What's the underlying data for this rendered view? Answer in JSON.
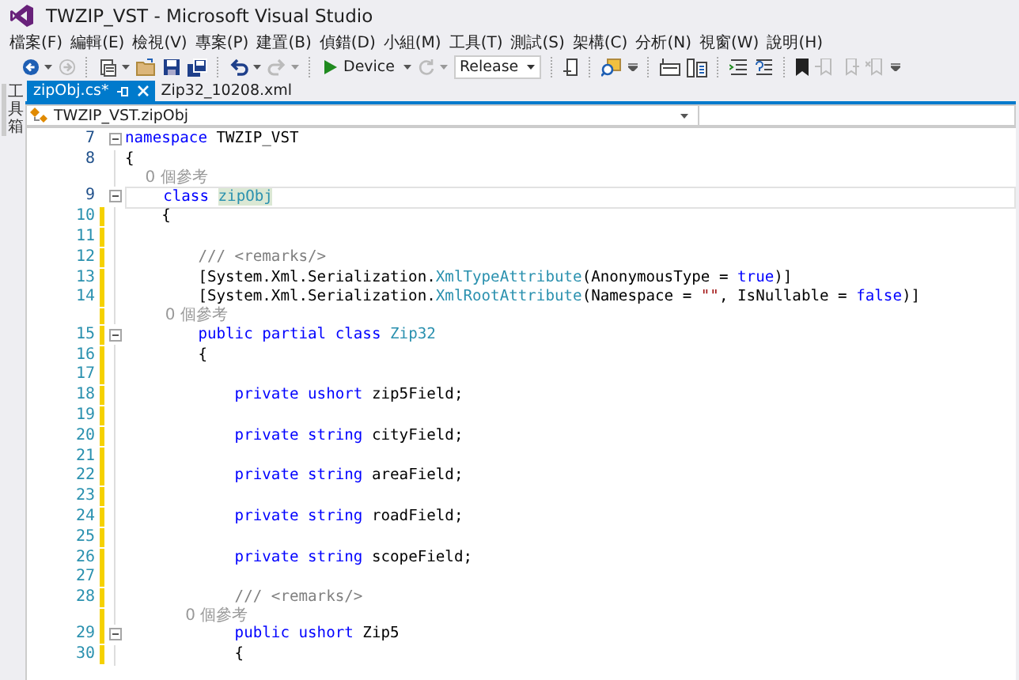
{
  "window": {
    "title": "TWZIP_VST - Microsoft Visual Studio"
  },
  "menu": [
    "檔案(F)",
    "編輯(E)",
    "檢視(V)",
    "專案(P)",
    "建置(B)",
    "偵錯(D)",
    "小組(M)",
    "工具(T)",
    "測試(S)",
    "架構(C)",
    "分析(N)",
    "視窗(W)",
    "說明(H)"
  ],
  "toolbar": {
    "forward": {
      "disabled": true
    },
    "redo": {
      "disabled": true
    },
    "run": {
      "label": "Device"
    },
    "refresh": {
      "disabled": true
    },
    "configuration": {
      "value": "Release"
    }
  },
  "side_panel": {
    "label": "工具箱"
  },
  "tabs": [
    {
      "label": "zipObj.cs*",
      "selected": true
    },
    {
      "label": "Zip32_10208.xml",
      "selected": false
    }
  ],
  "navigation_bar": {
    "value": "TWZIP_VST.zipObj"
  },
  "lines": [
    {
      "kind": "code",
      "number": "7",
      "fold": true,
      "changed": false,
      "tokens": [
        {
          "t": "namespace",
          "kind": "kw"
        },
        {
          "t": " TWZIP_VST",
          "kind": "plain"
        }
      ]
    },
    {
      "kind": "code",
      "number": "8",
      "changed": false,
      "tokens": [
        {
          "t": "{",
          "kind": "plain"
        }
      ]
    },
    {
      "kind": "codelens",
      "text": "    0 個參考"
    },
    {
      "kind": "code",
      "number": "9",
      "fold": true,
      "changed": false,
      "current": true,
      "tokens": [
        {
          "t": "    class ",
          "kind": "kw"
        },
        {
          "t": "zipObj",
          "kind": "highlight"
        }
      ]
    },
    {
      "kind": "code",
      "number": "10",
      "changed": true,
      "tokens": [
        {
          "t": "    {",
          "kind": "plain"
        }
      ]
    },
    {
      "kind": "code",
      "number": "11",
      "changed": true
    },
    {
      "kind": "code",
      "number": "12",
      "changed": true,
      "tokens": [
        {
          "t": "        /// <remarks/>",
          "kind": "comment"
        }
      ]
    },
    {
      "kind": "code",
      "number": "13",
      "changed": true,
      "tokens": [
        {
          "t": "        [System.Xml.Serialization.",
          "kind": "plain"
        },
        {
          "t": "XmlTypeAttribute",
          "kind": "type"
        },
        {
          "t": "(AnonymousType = ",
          "kind": "plain"
        },
        {
          "t": "true",
          "kind": "kw"
        },
        {
          "t": ")]",
          "kind": "plain"
        }
      ]
    },
    {
      "kind": "code",
      "number": "14",
      "changed": true,
      "tokens": [
        {
          "t": "        [System.Xml.Serialization.",
          "kind": "plain"
        },
        {
          "t": "XmlRootAttribute",
          "kind": "type"
        },
        {
          "t": "(Namespace = ",
          "kind": "plain"
        },
        {
          "t": "\"\"",
          "kind": "string"
        },
        {
          "t": ", IsNullable = ",
          "kind": "plain"
        },
        {
          "t": "false",
          "kind": "kw"
        },
        {
          "t": ")]",
          "kind": "plain"
        }
      ]
    },
    {
      "kind": "codelens",
      "changed": true,
      "text": "        0 個參考"
    },
    {
      "kind": "code",
      "number": "15",
      "fold": true,
      "changed": true,
      "tokens": [
        {
          "t": "        public partial class ",
          "kind": "kw"
        },
        {
          "t": "Zip32",
          "kind": "type"
        }
      ]
    },
    {
      "kind": "code",
      "number": "16",
      "changed": true,
      "tokens": [
        {
          "t": "        {",
          "kind": "plain"
        }
      ]
    },
    {
      "kind": "code",
      "number": "17",
      "changed": true
    },
    {
      "kind": "code",
      "number": "18",
      "changed": true,
      "tokens": [
        {
          "t": "            private ushort",
          "kind": "kw"
        },
        {
          "t": " zip5Field;",
          "kind": "plain"
        }
      ]
    },
    {
      "kind": "code",
      "number": "19",
      "changed": true
    },
    {
      "kind": "code",
      "number": "20",
      "changed": true,
      "tokens": [
        {
          "t": "            private string",
          "kind": "kw"
        },
        {
          "t": " cityField;",
          "kind": "plain"
        }
      ]
    },
    {
      "kind": "code",
      "number": "21",
      "changed": true
    },
    {
      "kind": "code",
      "number": "22",
      "changed": true,
      "tokens": [
        {
          "t": "            private string",
          "kind": "kw"
        },
        {
          "t": " areaField;",
          "kind": "plain"
        }
      ]
    },
    {
      "kind": "code",
      "number": "23",
      "changed": true
    },
    {
      "kind": "code",
      "number": "24",
      "changed": true,
      "tokens": [
        {
          "t": "            private string",
          "kind": "kw"
        },
        {
          "t": " roadField;",
          "kind": "plain"
        }
      ]
    },
    {
      "kind": "code",
      "number": "25",
      "changed": true
    },
    {
      "kind": "code",
      "number": "26",
      "changed": true,
      "tokens": [
        {
          "t": "            private string",
          "kind": "kw"
        },
        {
          "t": " scopeField;",
          "kind": "plain"
        }
      ]
    },
    {
      "kind": "code",
      "number": "27",
      "changed": true
    },
    {
      "kind": "code",
      "number": "28",
      "changed": true,
      "tokens": [
        {
          "t": "            /// <remarks/>",
          "kind": "comment"
        }
      ]
    },
    {
      "kind": "codelens",
      "changed": true,
      "text": "            0 個參考"
    },
    {
      "kind": "code",
      "number": "29",
      "fold": true,
      "changed": true,
      "tokens": [
        {
          "t": "            public ushort",
          "kind": "kw"
        },
        {
          "t": " Zip5",
          "kind": "plain"
        }
      ]
    },
    {
      "kind": "code",
      "number": "30",
      "changed": true,
      "tokens": [
        {
          "t": "            {",
          "kind": "plain"
        }
      ]
    }
  ]
}
